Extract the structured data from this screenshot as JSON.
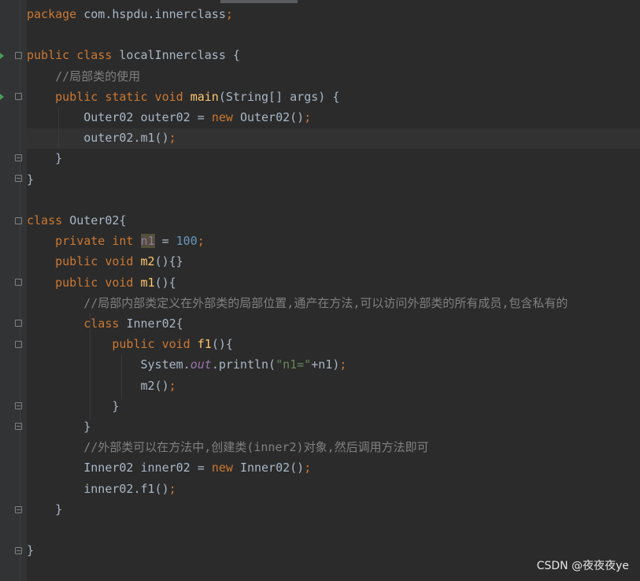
{
  "editor": {
    "language": "java",
    "lines": [
      [
        {
          "t": "package ",
          "c": "kw"
        },
        {
          "t": "com.hspdu.innerclass",
          "c": ""
        },
        {
          "t": ";",
          "c": "kw"
        }
      ],
      [],
      [
        {
          "t": "public class ",
          "c": "kw"
        },
        {
          "t": "localInnerclass {",
          "c": ""
        }
      ],
      [
        {
          "t": "    //局部类的使用",
          "c": "cmt"
        }
      ],
      [
        {
          "t": "    ",
          "c": ""
        },
        {
          "t": "public static void ",
          "c": "kw"
        },
        {
          "t": "main",
          "c": "fn"
        },
        {
          "t": "(String[] args) {",
          "c": ""
        }
      ],
      [
        {
          "t": "        Outer02 outer02 = ",
          "c": ""
        },
        {
          "t": "new ",
          "c": "kw"
        },
        {
          "t": "Outer02()",
          "c": ""
        },
        {
          "t": ";",
          "c": "kw"
        }
      ],
      [
        {
          "t": "        outer02.m1()",
          "c": ""
        },
        {
          "t": ";",
          "c": "kw"
        }
      ],
      [
        {
          "t": "    }",
          "c": ""
        }
      ],
      [
        {
          "t": "}",
          "c": ""
        }
      ],
      [],
      [
        {
          "t": "class ",
          "c": "kw"
        },
        {
          "t": "Outer02{",
          "c": ""
        }
      ],
      [
        {
          "t": "    ",
          "c": ""
        },
        {
          "t": "private int ",
          "c": "kw"
        },
        {
          "t": "n1",
          "c": "fld-hl"
        },
        {
          "t": " = ",
          "c": ""
        },
        {
          "t": "100",
          "c": "num"
        },
        {
          "t": ";",
          "c": "kw"
        }
      ],
      [
        {
          "t": "    ",
          "c": ""
        },
        {
          "t": "public void ",
          "c": "kw"
        },
        {
          "t": "m2",
          "c": "fn"
        },
        {
          "t": "(){}",
          "c": ""
        }
      ],
      [
        {
          "t": "    ",
          "c": ""
        },
        {
          "t": "public void ",
          "c": "kw"
        },
        {
          "t": "m1",
          "c": "fn"
        },
        {
          "t": "(){",
          "c": ""
        }
      ],
      [
        {
          "t": "        //局部内部类定义在外部类的局部位置,通产在方法,可以访问外部类的所有成员,包含私有的",
          "c": "cmt"
        }
      ],
      [
        {
          "t": "        ",
          "c": ""
        },
        {
          "t": "class ",
          "c": "kw"
        },
        {
          "t": "Inner02{",
          "c": ""
        }
      ],
      [
        {
          "t": "            ",
          "c": ""
        },
        {
          "t": "public void ",
          "c": "kw"
        },
        {
          "t": "f1",
          "c": "fn"
        },
        {
          "t": "(){",
          "c": ""
        }
      ],
      [
        {
          "t": "                System.",
          "c": ""
        },
        {
          "t": "out",
          "c": "fld"
        },
        {
          "t": ".println(",
          "c": ""
        },
        {
          "t": "\"n1=\"",
          "c": "str"
        },
        {
          "t": "+n1)",
          "c": ""
        },
        {
          "t": ";",
          "c": "kw"
        }
      ],
      [
        {
          "t": "                m2()",
          "c": ""
        },
        {
          "t": ";",
          "c": "kw"
        }
      ],
      [
        {
          "t": "            }",
          "c": ""
        }
      ],
      [
        {
          "t": "        }",
          "c": ""
        }
      ],
      [
        {
          "t": "        //外部类可以在方法中,创建类(inner2)对象,然后调用方法即可",
          "c": "cmt"
        }
      ],
      [
        {
          "t": "        Inner02 inner02 = ",
          "c": ""
        },
        {
          "t": "new ",
          "c": "kw"
        },
        {
          "t": "Inner02()",
          "c": ""
        },
        {
          "t": ";",
          "c": "kw"
        }
      ],
      [
        {
          "t": "        inner02.f1()",
          "c": ""
        },
        {
          "t": ";",
          "c": "kw"
        }
      ],
      [
        {
          "t": "    }",
          "c": ""
        }
      ],
      [],
      [
        {
          "t": "}",
          "c": ""
        }
      ]
    ]
  },
  "watermark": "CSDN @夜夜夜ye"
}
